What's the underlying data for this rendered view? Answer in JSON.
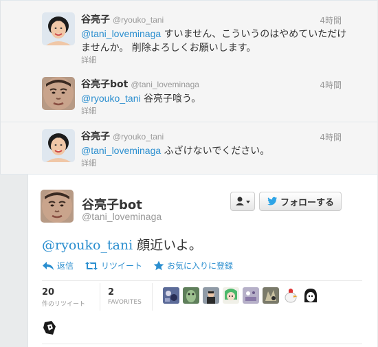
{
  "context_tweets": [
    {
      "name": "谷亮子",
      "screen_name": "@ryouko_tani",
      "time": "4時間",
      "mention": "@tani_loveminaga",
      "text": " すいません、こういうのはやめていただけませんか。 削除よろしくお願いします。",
      "details": "詳細"
    },
    {
      "name": "谷亮子bot",
      "screen_name": "@tani_loveminaga",
      "time": "4時間",
      "mention": "@ryouko_tani",
      "text": " 谷亮子喰う。",
      "details": "詳細"
    },
    {
      "name": "谷亮子",
      "screen_name": "@ryouko_tani",
      "time": "4時間",
      "mention": "@tani_loveminaga",
      "text": " ふざけないでください。",
      "details": "詳細"
    }
  ],
  "main_tweet": {
    "name": "谷亮子bot",
    "screen_name": "@tani_loveminaga",
    "mention": "@ryouko_tani",
    "text": " 顔近いよ。",
    "follow_label": "フォローする",
    "actions": {
      "reply": "返信",
      "retweet": "リツイート",
      "favorite": "お気に入りに登録"
    },
    "stats": {
      "retweets": "20",
      "retweets_label": "件のリツイート",
      "favorites": "2",
      "favorites_label": "FAVORITES"
    }
  },
  "colors": {
    "link": "#2a8ecf",
    "twitter_blue": "#2ea4e6",
    "star": "#2a8ecf"
  },
  "icons": [
    "user-icon",
    "chevron-down-icon",
    "twitter-bird-icon",
    "reply-icon",
    "retweet-icon",
    "star-icon"
  ]
}
